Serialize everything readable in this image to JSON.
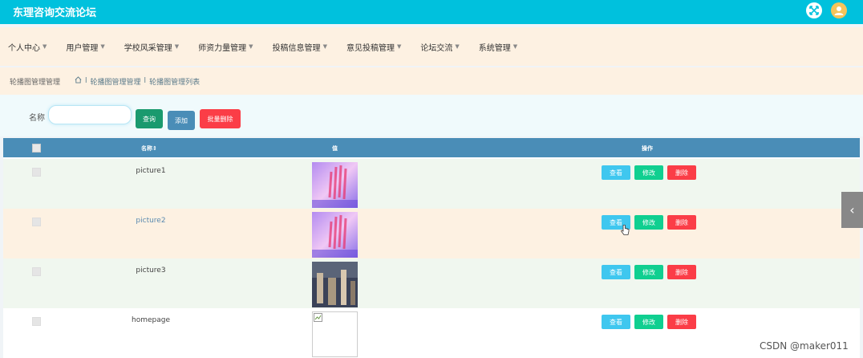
{
  "app": {
    "title": "东理咨询交流论坛"
  },
  "menu": [
    {
      "label": "个人中心"
    },
    {
      "label": "用户管理"
    },
    {
      "label": "学校风采管理"
    },
    {
      "label": "师资力量管理"
    },
    {
      "label": "投稿信息管理"
    },
    {
      "label": "意见投稿管理"
    },
    {
      "label": "论坛交流"
    },
    {
      "label": "系统管理"
    }
  ],
  "breadcrumb": {
    "current": "轮播图管理管理",
    "path": [
      "轮播图管理管理",
      "轮播图管理列表"
    ],
    "separator": "l"
  },
  "search": {
    "label": "名称",
    "value": "",
    "placeholder": ""
  },
  "buttons": {
    "search": "查询",
    "add": "添加",
    "batch_delete": "批量删除"
  },
  "table": {
    "columns": {
      "name": "名称",
      "value": "值",
      "actions": "操作"
    },
    "rows": [
      {
        "name": "picture1",
        "image": "purple-blur"
      },
      {
        "name": "picture2",
        "image": "purple-blur"
      },
      {
        "name": "picture3",
        "image": "dark-photo"
      },
      {
        "name": "homepage",
        "image": "broken-image"
      }
    ],
    "row_actions": {
      "view": "查看",
      "edit": "修改",
      "delete": "删除"
    }
  },
  "watermark": "CSDN @maker011",
  "colors": {
    "topbar": "#00c1dd",
    "menubar": "#fdf1e2",
    "table_header": "#4a8db7",
    "view": "#3fc7ef",
    "edit": "#10cf90",
    "delete": "#fb3d47"
  }
}
